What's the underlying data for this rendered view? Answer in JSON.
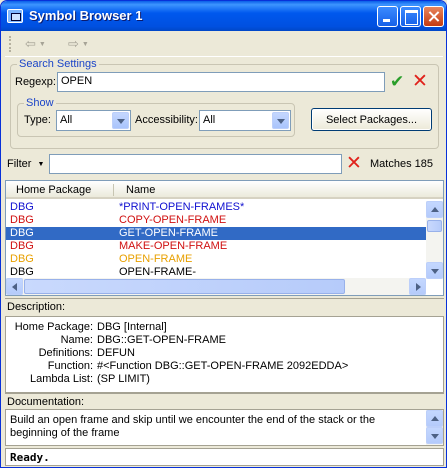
{
  "window": {
    "title": "Symbol Browser 1"
  },
  "toolbar": {
    "back_icon": "back-arrow-icon",
    "forward_icon": "forward-arrow-icon"
  },
  "search": {
    "group_label": "Search Settings",
    "regexp_label": "Regexp:",
    "regexp_value": "OPEN",
    "show_label": "Show",
    "type_label": "Type:",
    "type_value": "All",
    "accessibility_label": "Accessibility:",
    "accessibility_value": "All",
    "select_packages_label": "Select Packages..."
  },
  "filter": {
    "label": "Filter",
    "value": "",
    "matches_label": "Matches",
    "matches_count": "185"
  },
  "list": {
    "columns": [
      "Home Package",
      "Name"
    ],
    "rows": [
      {
        "package": "DBG",
        "name": "*PRINT-OPEN-FRAMES*",
        "pkg_color": "#1010d0",
        "name_color": "#1010d0"
      },
      {
        "package": "DBG",
        "name": "COPY-OPEN-FRAME",
        "pkg_color": "#d01010",
        "name_color": "#d01010"
      },
      {
        "package": "DBG",
        "name": "GET-OPEN-FRAME",
        "pkg_color": "#ffffff",
        "name_color": "#ffffff",
        "selected": true
      },
      {
        "package": "DBG",
        "name": "MAKE-OPEN-FRAME",
        "pkg_color": "#d01010",
        "name_color": "#d01010"
      },
      {
        "package": "DBG",
        "name": "OPEN-FRAME",
        "pkg_color": "#e8a000",
        "name_color": "#e8a000"
      },
      {
        "package": "DBG",
        "name": "OPEN-FRAME-",
        "pkg_color": "#000000",
        "name_color": "#000000"
      }
    ]
  },
  "description": {
    "label": "Description:",
    "home_package_k": "Home Package:",
    "home_package_v": "DBG [Internal]",
    "name_k": "Name:",
    "name_v": "DBG::GET-OPEN-FRAME",
    "definitions_k": "Definitions:",
    "definitions_v": "DEFUN",
    "function_k": "Function:",
    "function_v": "#<Function DBG::GET-OPEN-FRAME 2092EDDA>",
    "lambda_k": "Lambda List:",
    "lambda_v": "(SP LIMIT)"
  },
  "documentation": {
    "label": "Documentation:",
    "text": "Build an open frame and skip until we encounter the end of the stack or the beginning of the frame"
  },
  "status": {
    "text": "Ready."
  },
  "colors": {
    "title_bar": "#0058ee",
    "selection": "#316ac5",
    "accent": "#1c45c8"
  }
}
